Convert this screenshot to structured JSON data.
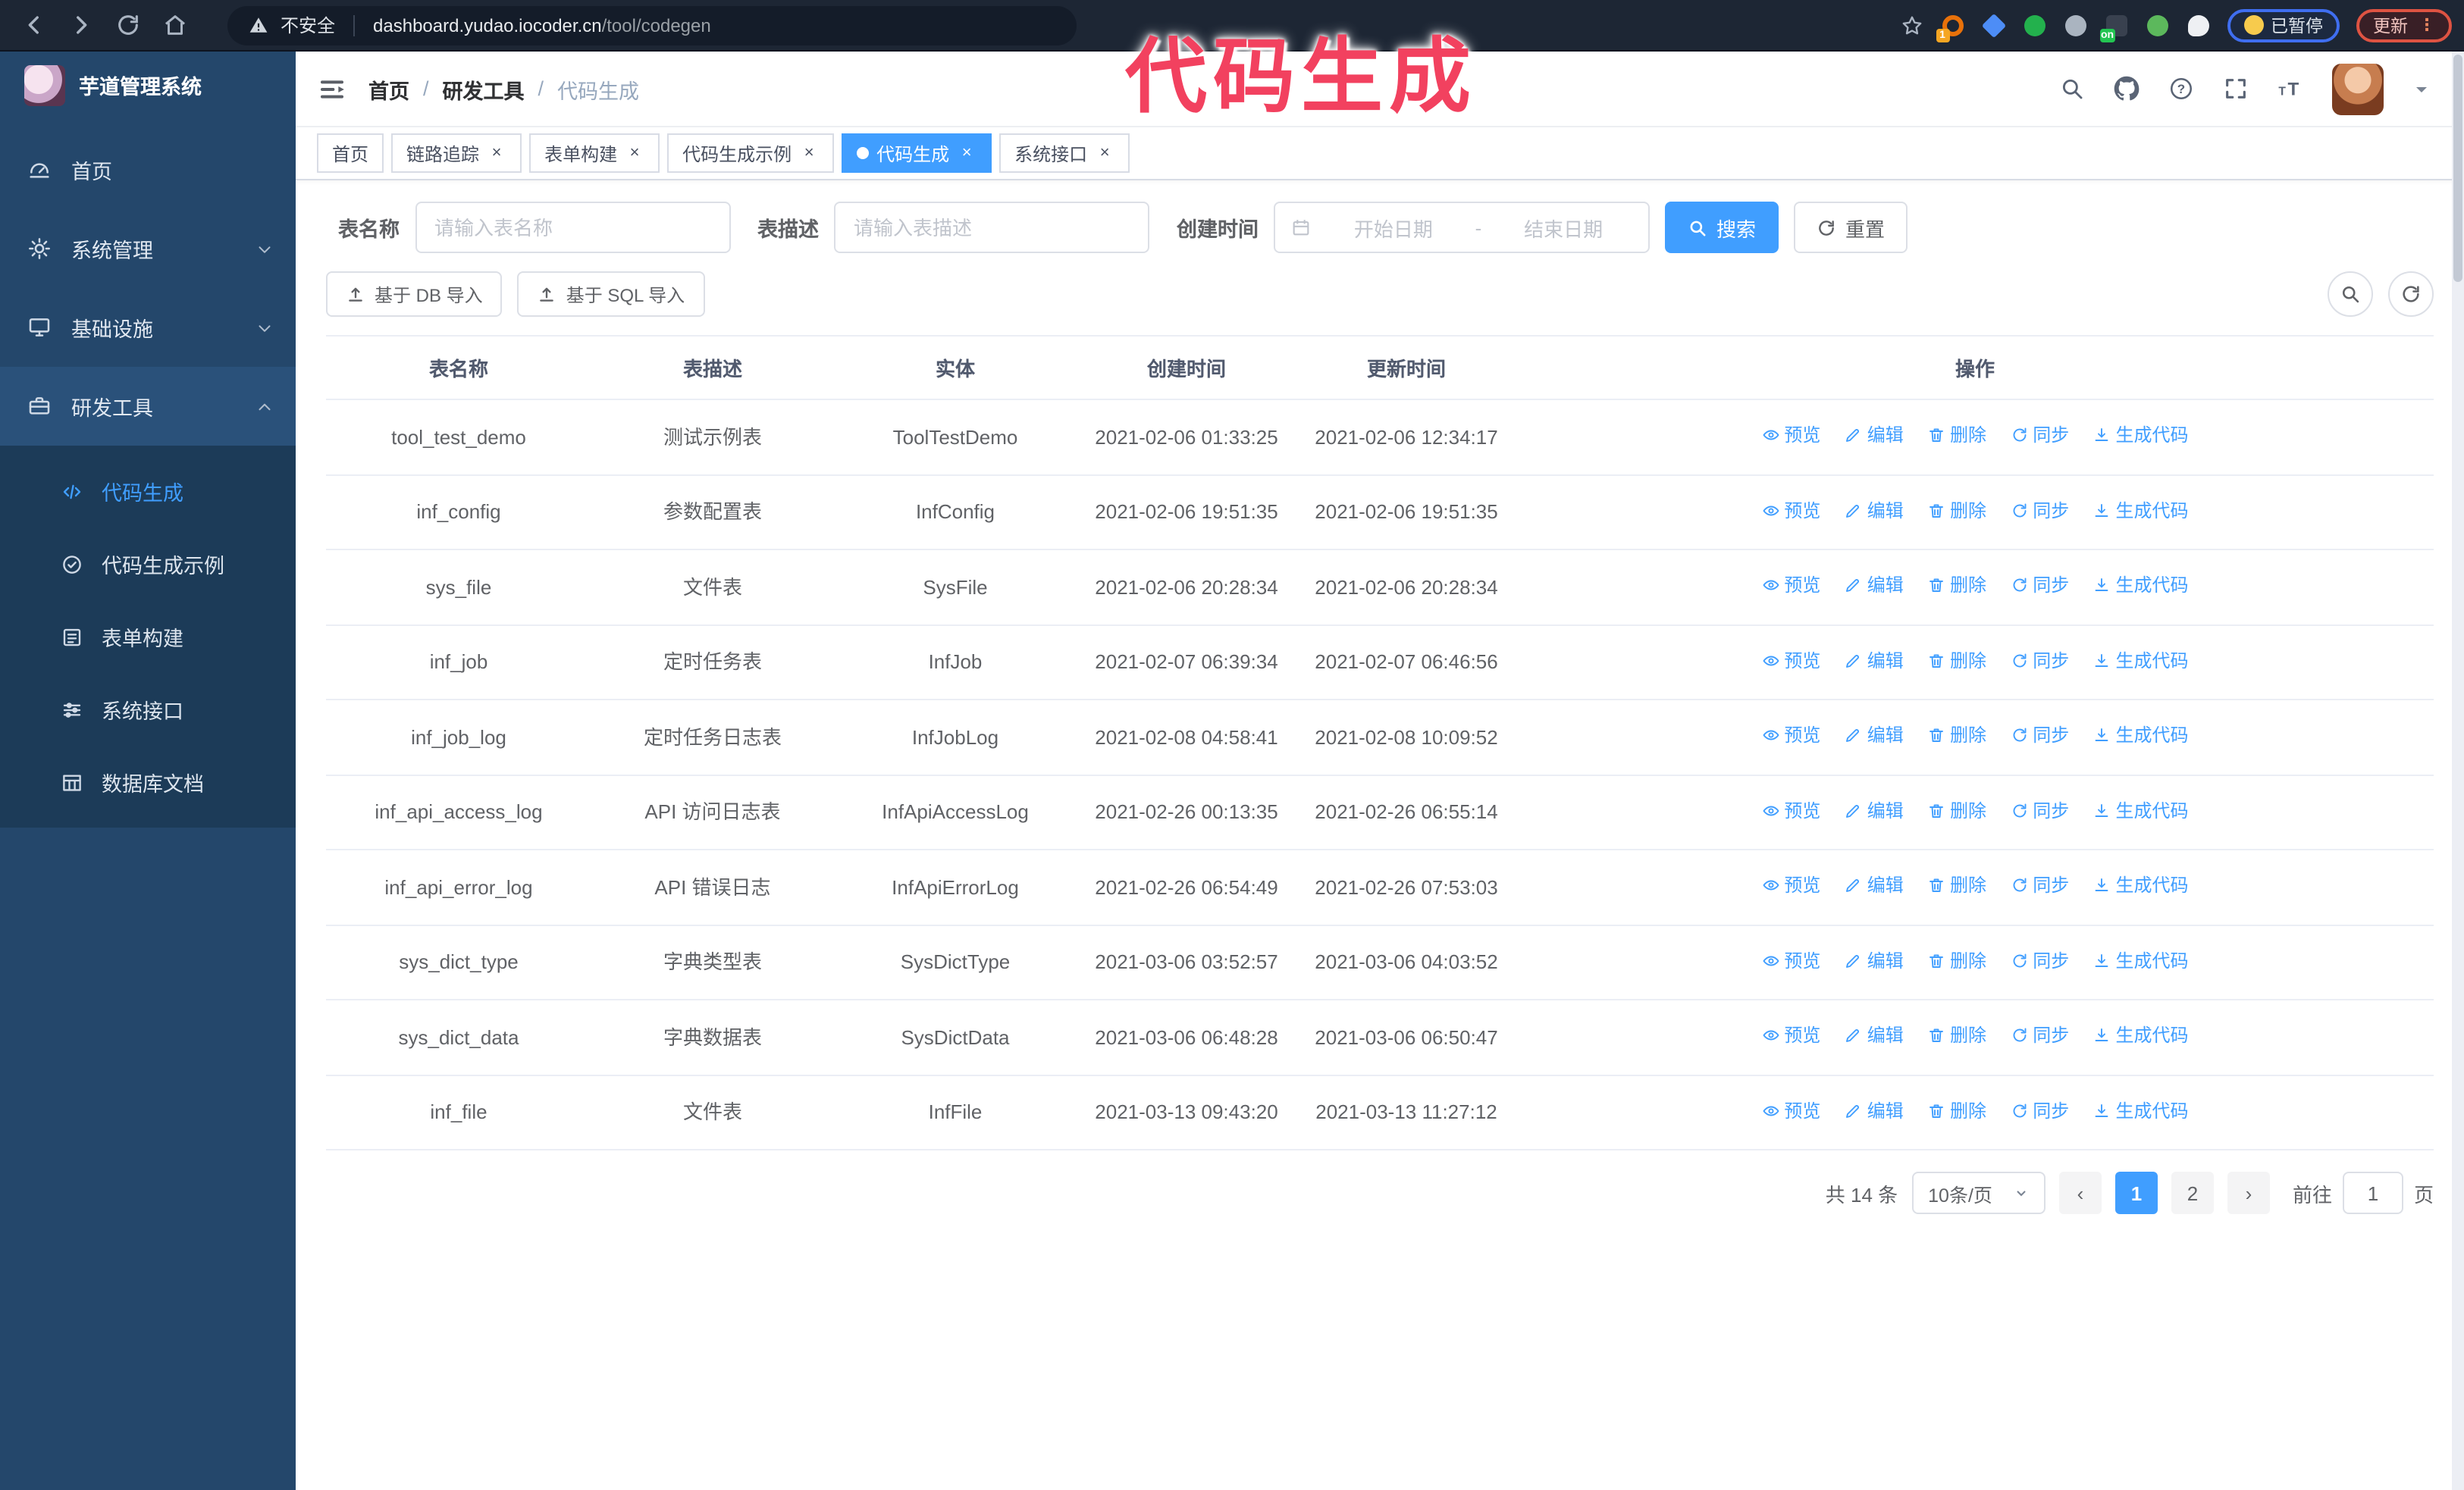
{
  "browser": {
    "security": "不安全",
    "url_host": "dashboard.yudao.iocoder.cn",
    "url_path": "/tool/codegen",
    "paused_label": "已暂停",
    "update_label": "更新",
    "extensions": [
      {
        "name": "extension-icon",
        "shape": "ring",
        "color": "#e8710a",
        "badge": "1",
        "badge_color": "#f5a623"
      },
      {
        "name": "extension-icon",
        "shape": "diamond",
        "color": "#4d8df6"
      },
      {
        "name": "extension-icon",
        "shape": "circle",
        "color": "#23b14d"
      },
      {
        "name": "extension-icon",
        "shape": "circle",
        "color": "#aab4c0"
      },
      {
        "name": "extension-icon",
        "shape": "square",
        "color": "#39414f",
        "badge": "on",
        "badge_color": "#23c552"
      },
      {
        "name": "extension-icon",
        "shape": "circle",
        "color": "#5cb85c"
      },
      {
        "name": "extension-icon",
        "shape": "flower",
        "color": "#eef0f3"
      }
    ]
  },
  "annotation": {
    "text": "代码生成",
    "color": "#F2415F"
  },
  "sidebar": {
    "title": "芋道管理系统",
    "items": [
      {
        "label": "首页",
        "icon": "dashboard",
        "chevron": ""
      },
      {
        "label": "系统管理",
        "icon": "gear",
        "chevron": "chevron-down"
      },
      {
        "label": "基础设施",
        "icon": "monitor",
        "chevron": "chevron-down"
      },
      {
        "label": "研发工具",
        "icon": "toolbox",
        "chevron": "chevron-up",
        "highlight": true
      }
    ],
    "submenu": [
      {
        "label": "代码生成",
        "icon": "code",
        "active": true
      },
      {
        "label": "代码生成示例",
        "icon": "circle-check"
      },
      {
        "label": "表单构建",
        "icon": "form"
      },
      {
        "label": "系统接口",
        "icon": "sliders"
      },
      {
        "label": "数据库文档",
        "icon": "table-grid"
      }
    ]
  },
  "breadcrumb": [
    {
      "label": "首页"
    },
    {
      "label": "研发工具"
    },
    {
      "label": "代码生成",
      "current": true
    }
  ],
  "tabs": [
    {
      "label": "首页"
    },
    {
      "label": "链路追踪",
      "closable": true
    },
    {
      "label": "表单构建",
      "closable": true
    },
    {
      "label": "代码生成示例",
      "closable": true
    },
    {
      "label": "代码生成",
      "closable": true,
      "active": true
    },
    {
      "label": "系统接口",
      "closable": true
    }
  ],
  "filters": {
    "table_name_label": "表名称",
    "table_name_placeholder": "请输入表名称",
    "table_desc_label": "表描述",
    "table_desc_placeholder": "请输入表描述",
    "create_time_label": "创建时间",
    "start_placeholder": "开始日期",
    "range_separator": "-",
    "end_placeholder": "结束日期",
    "search_label": "搜索",
    "reset_label": "重置"
  },
  "toolbar": {
    "import_db_label": "基于 DB 导入",
    "import_sql_label": "基于 SQL 导入"
  },
  "table": {
    "columns": [
      {
        "label": "表名称"
      },
      {
        "label": "表描述"
      },
      {
        "label": "实体"
      },
      {
        "label": "创建时间"
      },
      {
        "label": "更新时间"
      },
      {
        "label": "操作"
      }
    ],
    "actions": [
      {
        "label": "预览",
        "icon": "eye"
      },
      {
        "label": "编辑",
        "icon": "pen"
      },
      {
        "label": "删除",
        "icon": "trash"
      },
      {
        "label": "同步",
        "icon": "sync"
      },
      {
        "label": "生成代码",
        "icon": "download"
      }
    ],
    "rows": [
      {
        "name": "tool_test_demo",
        "desc": "测试示例表",
        "entity": "ToolTestDemo",
        "created": "2021-02-06 01:33:25",
        "updated": "2021-02-06 12:34:17"
      },
      {
        "name": "inf_config",
        "desc": "参数配置表",
        "entity": "InfConfig",
        "created": "2021-02-06 19:51:35",
        "updated": "2021-02-06 19:51:35"
      },
      {
        "name": "sys_file",
        "desc": "文件表",
        "entity": "SysFile",
        "created": "2021-02-06 20:28:34",
        "updated": "2021-02-06 20:28:34"
      },
      {
        "name": "inf_job",
        "desc": "定时任务表",
        "entity": "InfJob",
        "created": "2021-02-07 06:39:34",
        "updated": "2021-02-07 06:46:56"
      },
      {
        "name": "inf_job_log",
        "desc": "定时任务日志表",
        "entity": "InfJobLog",
        "created": "2021-02-08 04:58:41",
        "updated": "2021-02-08 10:09:52"
      },
      {
        "name": "inf_api_access_log",
        "desc": "API 访问日志表",
        "entity": "InfApiAccessLog",
        "created": "2021-02-26 00:13:35",
        "updated": "2021-02-26 06:55:14"
      },
      {
        "name": "inf_api_error_log",
        "desc": "API 错误日志",
        "entity": "InfApiErrorLog",
        "created": "2021-02-26 06:54:49",
        "updated": "2021-02-26 07:53:03"
      },
      {
        "name": "sys_dict_type",
        "desc": "字典类型表",
        "entity": "SysDictType",
        "created": "2021-03-06 03:52:57",
        "updated": "2021-03-06 04:03:52"
      },
      {
        "name": "sys_dict_data",
        "desc": "字典数据表",
        "entity": "SysDictData",
        "created": "2021-03-06 06:48:28",
        "updated": "2021-03-06 06:50:47"
      },
      {
        "name": "inf_file",
        "desc": "文件表",
        "entity": "InfFile",
        "created": "2021-03-13 09:43:20",
        "updated": "2021-03-13 11:27:12"
      }
    ]
  },
  "pagination": {
    "total": "共 14 条",
    "page_size": "10条/页",
    "pages": [
      {
        "label": "1",
        "active": true
      },
      {
        "label": "2"
      }
    ],
    "goto_label": "前往",
    "goto_value": "1",
    "unit_label": "页"
  },
  "colors": {
    "accent": "#409EFF",
    "annotation": "#F2415F"
  }
}
